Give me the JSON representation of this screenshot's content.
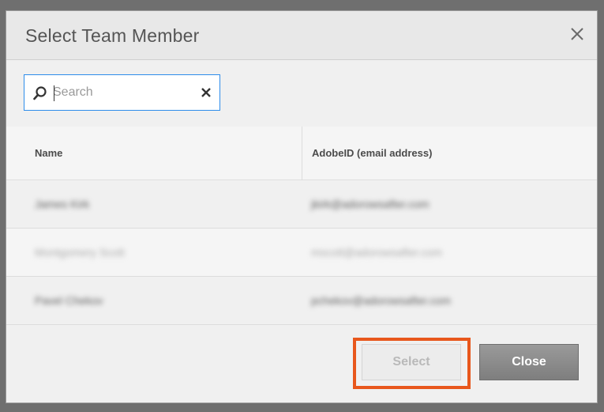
{
  "dialog": {
    "title": "Select Team Member",
    "close_icon": "close-icon"
  },
  "search": {
    "placeholder": "Search",
    "value": "",
    "search_icon": "search-icon",
    "clear_icon": "clear-icon"
  },
  "table": {
    "columns": [
      "Name",
      "AdobeID (email address)"
    ],
    "rows": [
      {
        "name": "James Kirk",
        "email": "jkirk@adorowsafter.com",
        "disabled": false
      },
      {
        "name": "Montgomery Scott",
        "email": "mscott@adorowsafter.com",
        "disabled": true
      },
      {
        "name": "Pavel Chekov",
        "email": "pchekov@adorowsafter.com",
        "disabled": false
      }
    ]
  },
  "buttons": {
    "select_label": "Select",
    "close_label": "Close"
  },
  "colors": {
    "highlight": "#e8571c",
    "search_border": "#2d8ceb"
  }
}
